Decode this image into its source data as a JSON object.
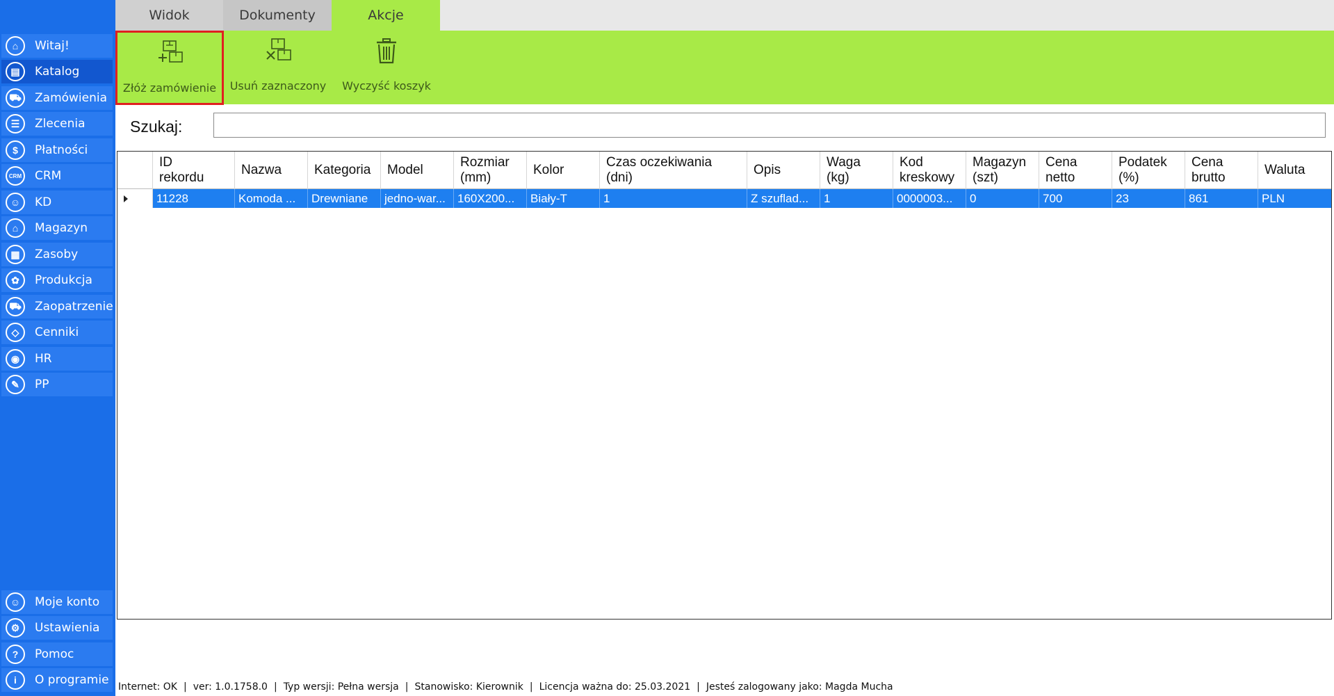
{
  "tabs": {
    "widok": "Widok",
    "dokumenty": "Dokumenty",
    "akcje": "Akcje"
  },
  "sidebar": {
    "items": [
      {
        "label": "Witaj!",
        "icon": "home-icon"
      },
      {
        "label": "Katalog",
        "icon": "catalog-icon",
        "active": true
      },
      {
        "label": "Zamówienia",
        "icon": "cart-icon"
      },
      {
        "label": "Zlecenia",
        "icon": "tasks-icon"
      },
      {
        "label": "Płatności",
        "icon": "dollar-icon"
      },
      {
        "label": "CRM",
        "icon": "crm-icon",
        "glyph": "CRM"
      },
      {
        "label": "KD",
        "icon": "person-icon"
      },
      {
        "label": "Magazyn",
        "icon": "warehouse-icon"
      },
      {
        "label": "Zasoby",
        "icon": "resources-icon"
      },
      {
        "label": "Produkcja",
        "icon": "production-icon"
      },
      {
        "label": "Zaopatrzenie",
        "icon": "truck-icon"
      },
      {
        "label": "Cenniki",
        "icon": "tag-icon"
      },
      {
        "label": "HR",
        "icon": "hr-icon"
      },
      {
        "label": "PP",
        "icon": "pp-icon"
      }
    ],
    "bottom_items": [
      {
        "label": "Moje konto",
        "icon": "account-icon"
      },
      {
        "label": "Ustawienia",
        "icon": "settings-icon"
      },
      {
        "label": "Pomoc",
        "icon": "help-icon"
      },
      {
        "label": "O programie",
        "icon": "info-icon"
      }
    ]
  },
  "ribbon": {
    "place_order": "Złóż zamówienie",
    "remove_selected": "Usuń zaznaczony",
    "clear_cart": "Wyczyść koszyk"
  },
  "search": {
    "label": "Szukaj:",
    "value": ""
  },
  "grid": {
    "columns": [
      "ID\nrekordu",
      "Nazwa",
      "Kategoria",
      "Model",
      "Rozmiar\n(mm)",
      "Kolor",
      "Czas oczekiwania\n(dni)",
      "Opis",
      "Waga\n(kg)",
      "Kod\nkreskowy",
      "Magazyn\n(szt)",
      "Cena\nnetto",
      "Podatek\n(%)",
      "Cena\nbrutto",
      "Waluta"
    ],
    "rows": [
      [
        "11228",
        "Komoda ...",
        "Drewniane",
        "jedno-war...",
        "160X200...",
        "Biały-T",
        "1",
        "Z szuflad...",
        "1",
        "0000003...",
        "0",
        "700",
        "23",
        "861",
        "PLN"
      ]
    ]
  },
  "status": {
    "internet": "Internet: OK",
    "version": "ver: 1.0.1758.0",
    "type": "Typ wersji: Pełna wersja",
    "station": "Stanowisko: Kierownik",
    "license": "Licencja ważna do: 25.03.2021",
    "user": "Jesteś zalogowany jako: Magda Mucha"
  },
  "colors": {
    "sidebar": "#1a6ee8",
    "ribbon": "#a8ea47",
    "selected_row": "#1e7ff0",
    "highlight_border": "#e02020"
  }
}
